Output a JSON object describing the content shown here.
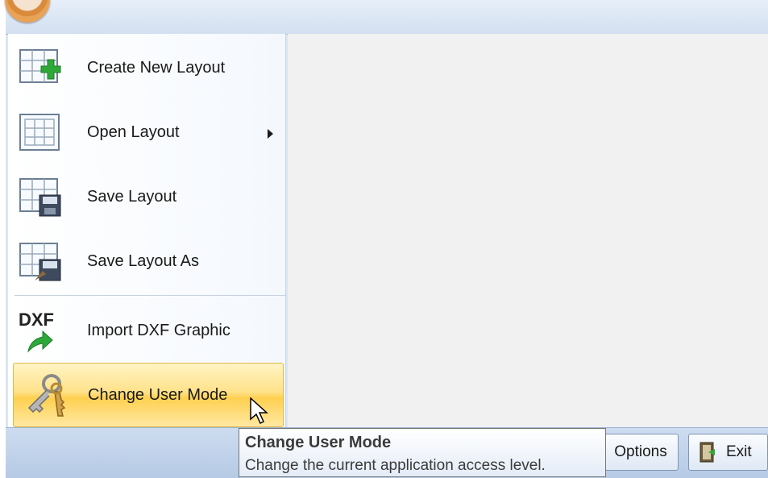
{
  "menu": {
    "items": [
      {
        "label": "Create New Layout",
        "icon": "grid-add-icon",
        "has_submenu": false
      },
      {
        "label": "Open Layout",
        "icon": "grid-open-icon",
        "has_submenu": true
      },
      {
        "label": "Save Layout",
        "icon": "grid-save-icon",
        "has_submenu": false
      },
      {
        "label": "Save Layout As",
        "icon": "grid-save-as-icon",
        "has_submenu": false
      },
      {
        "label": "Import DXF Graphic",
        "icon": "dxf-import-icon",
        "icon_text": "DXF",
        "has_submenu": false
      },
      {
        "label": "Change User Mode",
        "icon": "keys-icon",
        "has_submenu": false,
        "highlighted": true
      }
    ]
  },
  "footer": {
    "options_label": "Options",
    "exit_label": "Exit"
  },
  "tooltip": {
    "title": "Change User Mode",
    "body": "Change the current application access level."
  },
  "colors": {
    "highlight": "#ffd051",
    "frame": "#dbe6f4",
    "plus": "#2fa83a"
  }
}
